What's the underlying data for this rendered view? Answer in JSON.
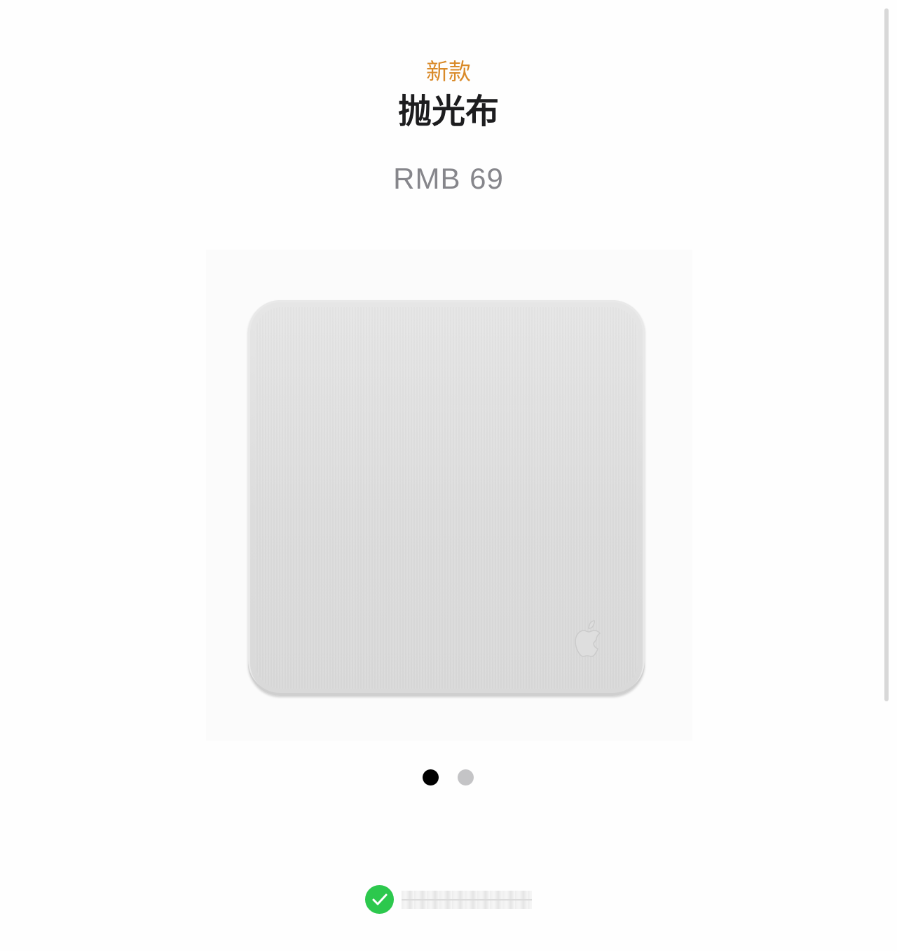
{
  "product": {
    "badge": "新款",
    "title": "抛光布",
    "price": "RMB 69"
  },
  "gallery": {
    "image_icon": "apple-logo-icon",
    "page_count": 2,
    "active_index": 0
  },
  "footer": {
    "status_icon": "green-check-icon"
  },
  "colors": {
    "badge": "#d98a29",
    "title": "#1d1d1f",
    "price": "#86868b",
    "dot_active": "#000000",
    "dot_inactive": "#c4c4c6",
    "check": "#2cc84d"
  }
}
